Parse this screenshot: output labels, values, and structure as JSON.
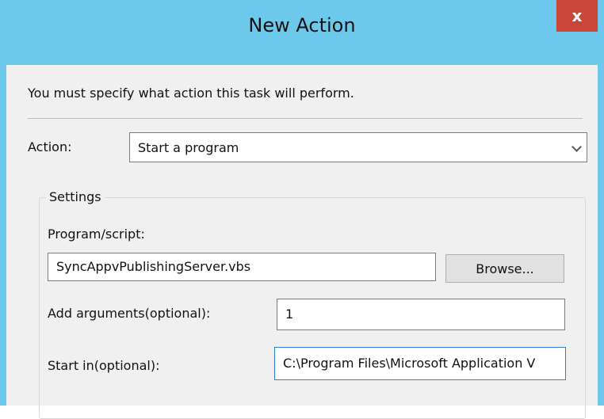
{
  "window": {
    "title": "New Action",
    "close_glyph": "x"
  },
  "dialog": {
    "instruction": "You must specify what action this task will perform.",
    "action": {
      "label": "Action:",
      "selected_value": "Start a program"
    },
    "settings": {
      "legend": "Settings",
      "program_label": "Program/script:",
      "program_value": "SyncAppvPublishingServer.vbs",
      "browse_label": "Browse...",
      "arguments_label": "Add arguments(optional):",
      "arguments_value": "1",
      "start_in_label": "Start in(optional):",
      "start_in_value": "C:\\Program Files\\Microsoft Application V"
    }
  },
  "colors": {
    "title_bar": "#6cc9ec",
    "close_button": "#c9473a",
    "focus_border": "#2f7fd8"
  }
}
